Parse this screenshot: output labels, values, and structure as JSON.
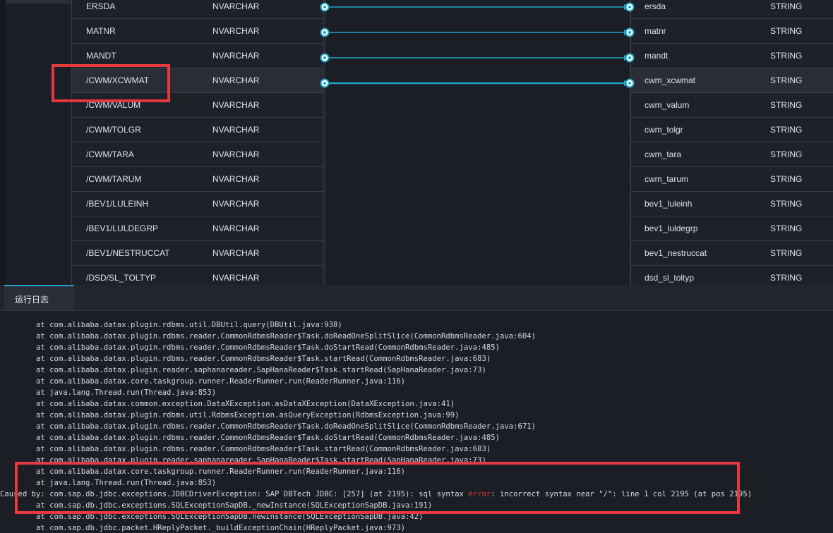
{
  "mapping": {
    "source_rows": [
      {
        "name": "ERSDA",
        "type": "NVARCHAR"
      },
      {
        "name": "MATNR",
        "type": "NVARCHAR"
      },
      {
        "name": "MANDT",
        "type": "NVARCHAR"
      },
      {
        "name": "/CWM/XCWMAT",
        "type": "NVARCHAR"
      },
      {
        "name": "/CWM/VALUM",
        "type": "NVARCHAR"
      },
      {
        "name": "/CWM/TOLGR",
        "type": "NVARCHAR"
      },
      {
        "name": "/CWM/TARA",
        "type": "NVARCHAR"
      },
      {
        "name": "/CWM/TARUM",
        "type": "NVARCHAR"
      },
      {
        "name": "/BEV1/LULEINH",
        "type": "NVARCHAR"
      },
      {
        "name": "/BEV1/LULDEGRP",
        "type": "NVARCHAR"
      },
      {
        "name": "/BEV1/NESTRUCCAT",
        "type": "NVARCHAR"
      },
      {
        "name": "/DSD/SL_TOLTYP",
        "type": "NVARCHAR"
      }
    ],
    "target_rows": [
      {
        "name": "ersda",
        "type": "STRING"
      },
      {
        "name": "matnr",
        "type": "STRING"
      },
      {
        "name": "mandt",
        "type": "STRING"
      },
      {
        "name": "cwm_xcwmat",
        "type": "STRING"
      },
      {
        "name": "cwm_valum",
        "type": "STRING"
      },
      {
        "name": "cwm_tolgr",
        "type": "STRING"
      },
      {
        "name": "cwm_tara",
        "type": "STRING"
      },
      {
        "name": "cwm_tarum",
        "type": "STRING"
      },
      {
        "name": "bev1_luleinh",
        "type": "STRING"
      },
      {
        "name": "bev1_luldegrp",
        "type": "STRING"
      },
      {
        "name": "bev1_nestruccat",
        "type": "STRING"
      },
      {
        "name": "dsd_sl_toltyp",
        "type": "STRING"
      }
    ],
    "connected_count": 4,
    "link_color": "#1fa4c7"
  },
  "log": {
    "tab_label": "运行日志",
    "lines": [
      "        at com.alibaba.datax.plugin.rdbms.util.DBUtil.query(DBUtil.java:938)",
      "        at com.alibaba.datax.plugin.rdbms.reader.CommonRdbmsReader$Task.doReadOneSplitSlice(CommonRdbmsReader.java:604)",
      "        at com.alibaba.datax.plugin.rdbms.reader.CommonRdbmsReader$Task.doStartRead(CommonRdbmsReader.java:485)",
      "        at com.alibaba.datax.plugin.rdbms.reader.CommonRdbmsReader$Task.startRead(CommonRdbmsReader.java:683)",
      "        at com.alibaba.datax.plugin.reader.saphanareader.SapHanaReader$Task.startRead(SapHanaReader.java:73)",
      "        at com.alibaba.datax.core.taskgroup.runner.ReaderRunner.run(ReaderRunner.java:116)",
      "        at java.lang.Thread.run(Thread.java:853)",
      "        at com.alibaba.datax.common.exception.DataXException.asDataXException(DataXException.java:41)",
      "        at com.alibaba.datax.plugin.rdbms.util.RdbmsException.asQueryException(RdbmsException.java:99)",
      "        at com.alibaba.datax.plugin.rdbms.reader.CommonRdbmsReader$Task.doReadOneSplitSlice(CommonRdbmsReader.java:671)",
      "        at com.alibaba.datax.plugin.rdbms.reader.CommonRdbmsReader$Task.doStartRead(CommonRdbmsReader.java:485)",
      "        at com.alibaba.datax.plugin.rdbms.reader.CommonRdbmsReader$Task.startRead(CommonRdbmsReader.java:683)",
      "        at com.alibaba.datax.plugin.reader.saphanareader.SapHanaReader$Task.startRead(SapHanaReader.java:73)",
      "        at com.alibaba.datax.core.taskgroup.runner.ReaderRunner.run(ReaderRunner.java:116)",
      "        at java.lang.Thread.run(Thread.java:853)",
      "Caused by: com.sap.db.jdbc.exceptions.JDBCDriverException: SAP DBTech JDBC: [257] (at 2195): sql syntax error: incorrect syntax near \"/\": line 1 col 2195 (at pos 2195)",
      "        at com.sap.db.jdbc.exceptions.SQLExceptionSapDB._newInstance(SQLExceptionSapDB.java:191)",
      "        at com.sap.db.jdbc.exceptions.SQLExceptionSapDB.newInstance(SQLExceptionSapDB.java:42)",
      "        at com.sap.db.jdbc.packet.HReplyPacket._buildExceptionChain(HReplyPacket.java:973)"
    ],
    "error_word": "error",
    "error_color": "#d6383e"
  },
  "highlight_color": "#e8383f"
}
